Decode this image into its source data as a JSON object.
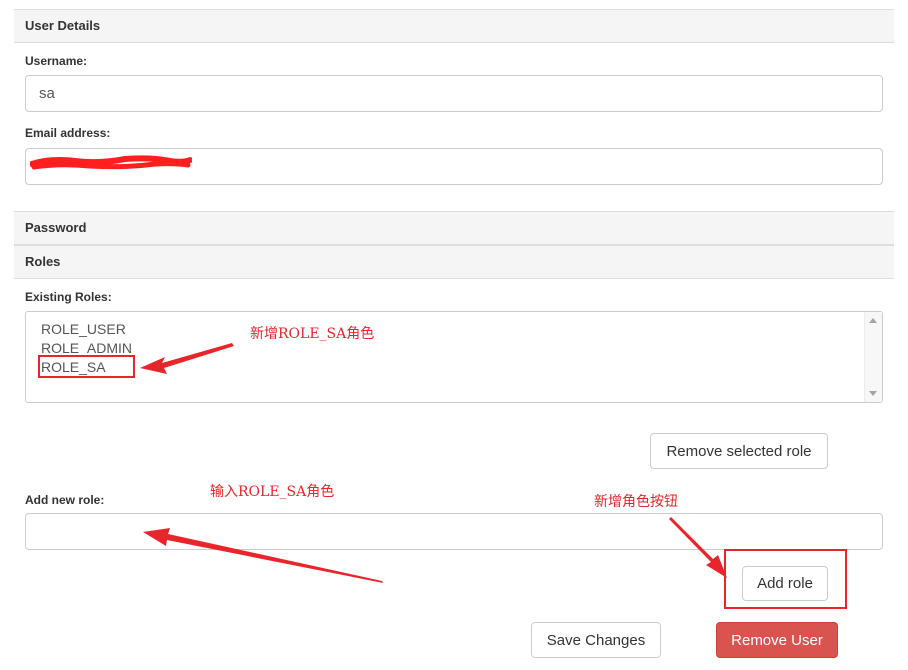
{
  "sections": {
    "user_details": "User Details",
    "password": "Password",
    "roles": "Roles"
  },
  "user_details": {
    "username_label": "Username:",
    "username_value": "sa",
    "email_label": "Email address:",
    "email_value": ""
  },
  "roles": {
    "existing_label": "Existing Roles:",
    "items": [
      "ROLE_USER",
      "ROLE_ADMIN",
      "ROLE_SA"
    ],
    "remove_selected_label": "Remove selected role",
    "add_new_label": "Add new role:",
    "new_role_value": "",
    "add_role_label": "Add role"
  },
  "actions": {
    "save_label": "Save Changes",
    "remove_user_label": "Remove User"
  },
  "annotations": {
    "new_role_note": "新增ROLE_SA角色",
    "input_role_note": "输入ROLE_SA角色",
    "add_button_note": "新增角色按钮"
  },
  "colors": {
    "annotation_red": "#e8252a",
    "danger_button": "#d9534f"
  }
}
